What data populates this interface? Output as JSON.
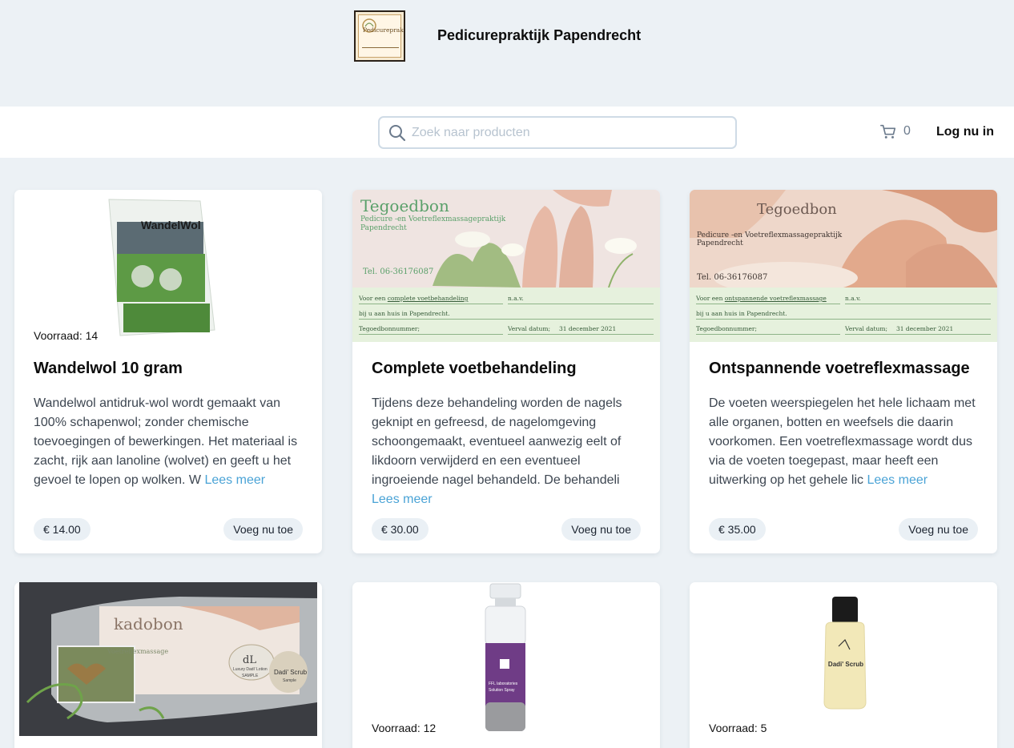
{
  "header": {
    "shop_name": "Pedicurepraktijk Papendrecht",
    "logo_text": "Pedicurepraktijk"
  },
  "search": {
    "placeholder": "Zoek naar producten",
    "value": ""
  },
  "cart": {
    "count": "0",
    "icon": "cart-icon"
  },
  "login_label": "Log nu in",
  "products": [
    {
      "stock": "Voorraad: 14",
      "title": "Wandelwol 10 gram",
      "description": "Wandelwol antidruk-wol wordt gemaakt van 100% schapenwol; zonder chemische toevoegingen of bewerkingen. Het materiaal is zacht, rijk aan lanoline (wolvet) en geeft u het gevoel te lopen op wolken. W",
      "read_more": "Lees meer",
      "price": "€ 14.00",
      "button": "Voeg nu toe",
      "image_text": "WandelWol"
    },
    {
      "title": "Complete voetbehandeling",
      "description": "Tijdens deze behandeling worden de nagels geknipt en gefreesd, de nagelomgeving schoongemaakt, eventueel aanwezig eelt of likdoorn verwijderd en een eventueel ingroeiende nagel behandeld. De behandeli",
      "read_more": "Lees meer",
      "price": "€ 30.00",
      "button": "Voeg nu toe",
      "voucher": {
        "title": "Tegoedbon",
        "subtitle": "Pedicure -en Voetreflexmassagepraktijk",
        "place": "Papendrecht",
        "phone": "Tel. 06-36176087",
        "line1_a": "Voor een",
        "line1_b": "complete voetbehandeling",
        "nav": "n.a.v.",
        "line2": "bij u aan huis in Papendrecht.",
        "number": "Tegoedbonnummer;",
        "expiry": "Verval datum;",
        "date": "31 december 2021"
      }
    },
    {
      "title": "Ontspannende voetreflexmassage",
      "description": "De voeten weerspiegelen het hele lichaam met alle organen, botten en weefsels die daarin voorkomen. Een voetreflexmassage wordt dus via de voeten toegepast, maar heeft een uitwerking op het gehele lic",
      "read_more": "Lees meer",
      "price": "€ 35.00",
      "button": "Voeg nu toe",
      "voucher": {
        "title": "Tegoedbon",
        "subtitle": "Pedicure -en Voetreflexmassagepraktijk",
        "place": "Papendrecht",
        "phone": "Tel. 06-36176087",
        "line1_a": "Voor een",
        "line1_b": "ontspannende voetreflexmassage",
        "nav": "n.a.v.",
        "line2": "bij u aan huis in Papendrecht.",
        "number": "Tegoedbonnummer;",
        "expiry": "Verval datum;",
        "date": "31 december 2021"
      }
    },
    {
      "image_text": "kadobon",
      "image_sub": "Voetreflexmassage",
      "jar_label": "dL",
      "jar_small": "Luxury Dadi' Lotion",
      "jar_sample": "SAMPLE",
      "scrub_label": "Dadi' Scrub",
      "scrub_sample": "Sample"
    },
    {
      "stock": "Voorraad: 12",
      "bottle_brand": "FFL laboratories",
      "bottle_name": "Solution Spray"
    },
    {
      "stock": "Voorraad: 5",
      "bottle_name": "Dadi' Scrub"
    }
  ]
}
